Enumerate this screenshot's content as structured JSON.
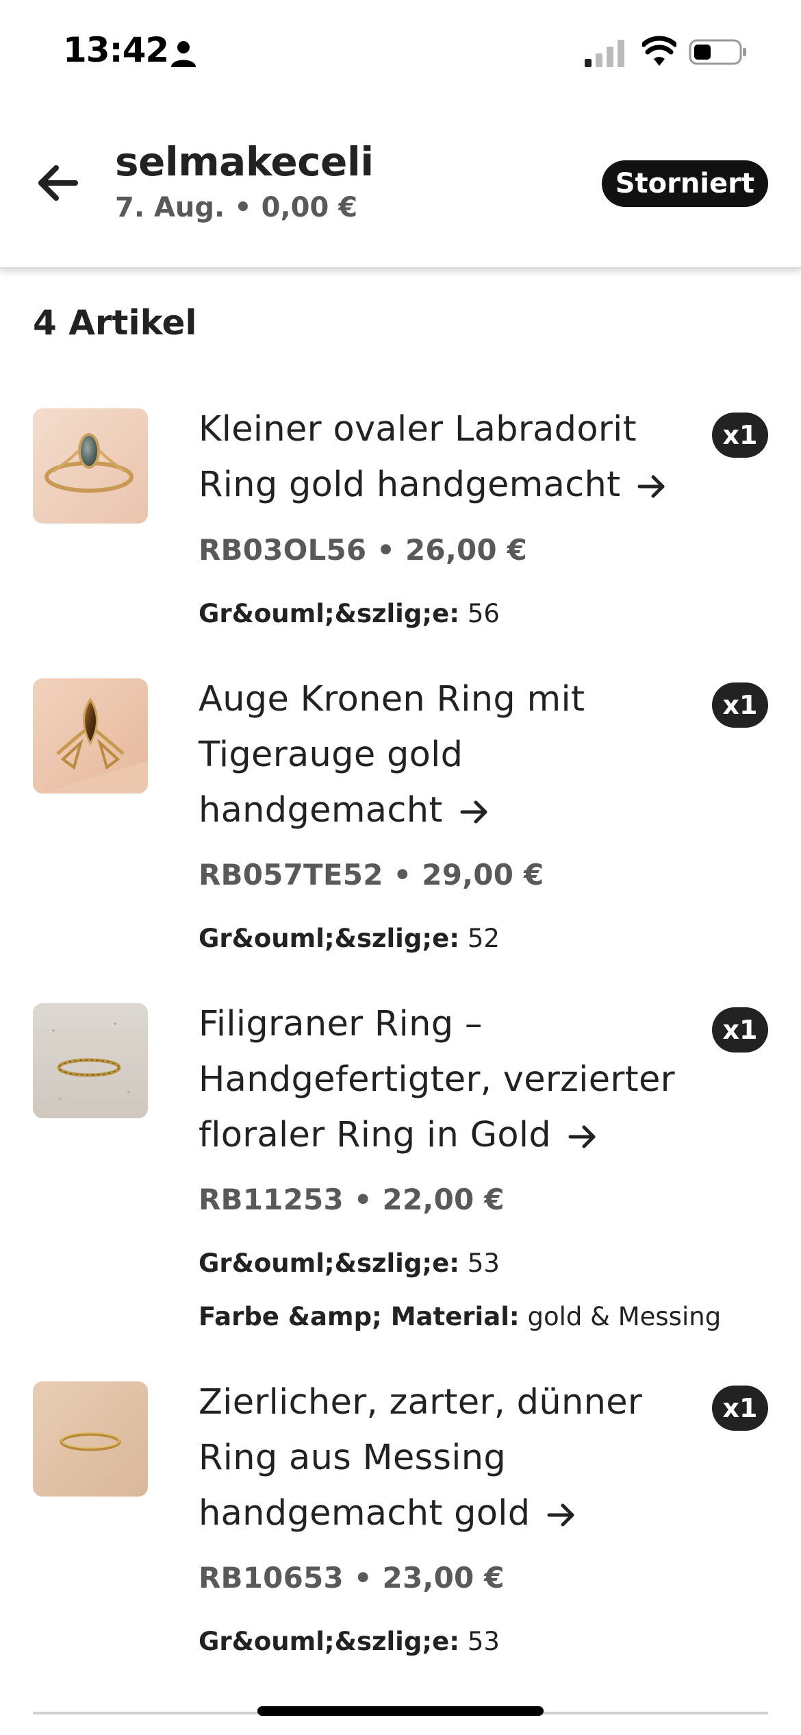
{
  "status_bar": {
    "time": "13:42",
    "icons": [
      "person-icon",
      "cellular-signal-icon",
      "wifi-icon",
      "battery-icon"
    ]
  },
  "header": {
    "back_icon": "arrow-left-icon",
    "shop_name": "selmakeceli",
    "order_meta": "7. Aug. • 0,00 €",
    "status_badge": "Storniert"
  },
  "items_count": "4 Artikel",
  "items": [
    {
      "title": "Kleiner ovaler Labradorit Ring gold handgemacht",
      "quantity": "x1",
      "sku_price": "RB03OL56 • 26,00 €",
      "attributes": [
        {
          "label": "Gr&ouml;&szlig;e:",
          "value": "56"
        }
      ]
    },
    {
      "title": "Auge Kronen Ring mit Tigerauge gold handgemacht",
      "quantity": "x1",
      "sku_price": "RB057TE52 • 29,00 €",
      "attributes": [
        {
          "label": "Gr&ouml;&szlig;e:",
          "value": "52"
        }
      ]
    },
    {
      "title": "Filigraner Ring – Handgefertigter, verzierter floraler Ring in Gold",
      "quantity": "x1",
      "sku_price": "RB11253 • 22,00 €",
      "attributes": [
        {
          "label": "Gr&ouml;&szlig;e:",
          "value": "53"
        },
        {
          "label": "Farbe &amp; Material:",
          "value": "gold & Messing"
        }
      ]
    },
    {
      "title": "Zierlicher, zarter, dünner Ring aus Messing handgemacht gold",
      "quantity": "x1",
      "sku_price": "RB10653 • 23,00 €",
      "attributes": [
        {
          "label": "Gr&ouml;&szlig;e:",
          "value": "53"
        }
      ]
    }
  ],
  "colors": {
    "badge_bg": "#111111",
    "text_primary": "#222222",
    "text_secondary": "#595959"
  }
}
